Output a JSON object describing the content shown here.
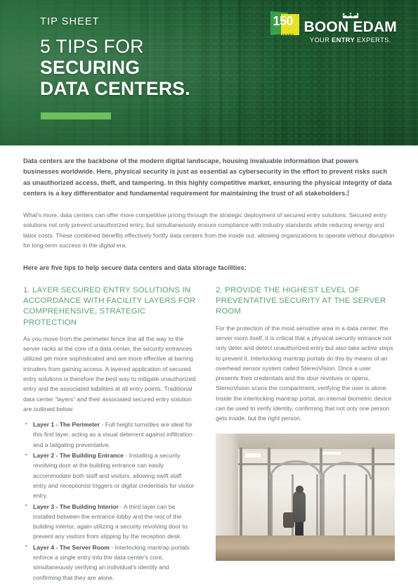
{
  "header": {
    "kicker": "TIP SHEET",
    "title_line_1": "5 TIPS FOR",
    "title_line_2": "SECURING",
    "title_line_3": "DATA CENTERS.",
    "accent_color": "#6ebf5d",
    "background_color": "#2d7a42",
    "photo_description": "data-center-server-racks-photo"
  },
  "logo": {
    "anniversary_number": "150",
    "anniversary_label": "YEARS",
    "brand": "BOON EDAM",
    "tagline_prefix": "YOUR ",
    "tagline_bold": "ENTRY",
    "tagline_suffix": " EXPERTS.",
    "badge_green": "#3aa14a",
    "badge_yellow": "#e6e324"
  },
  "intro": {
    "bold_paragraph": "Data centers are the backbone of the modern digital landscape, housing invaluable information that powers businesses worldwide. Here, physical security is just as essential as cybersecurity in the effort to prevent risks such as unauthorized access, theft, and tampering. In this highly competitive market, ensuring the physical integrity of data centers is a key differentiator and fundamental requirement for maintaining the trust of all stakeholders.",
    "regular_paragraph": "What's more, data centers can offer more competitive pricing through the strategic deployment of secured entry solutions. Secured entry solutions not only prevent unauthorized entry, but simultaneously ensure compliance with industry standards while reducing energy and labor costs. These combined benefits effectively fortify data centers from the inside out, allowing organizations to operate without disruption for long-term success in the digital era.",
    "lead_in": "Here are five tips to help secure data centers and data storage facilities:"
  },
  "sections": {
    "left": {
      "heading": "1. LAYER SECURED ENTRY SOLUTIONS IN ACCORDANCE WITH FACILITY LAYERS FOR COMPREHENSIVE, STRATEGIC PROTECTION",
      "body": "As you move from the perimeter fence line all the way to the server racks at the core of a data center, the security entrances utilized get more sophisticated and are more effective at barring intruders from gaining access. A layered application of secured entry solutions is therefore the best way to mitigate unauthorized entry and the associated liabilities at all entry points. Traditional data center “layers” and their associated secured entry solution are outlined below:",
      "bullets": [
        {
          "label": "Layer 1 - The Perimeter",
          "text": " - Full height turnstiles are ideal for this first layer, acting as a visual deterrent against infiltration and a tailgating preventative."
        },
        {
          "label": "Layer 2 - The Building Entrance",
          "text": " - Installing a security revolving door at the building entrance can easily accommodate both staff and visitors, allowing swift staff entry and receptionist triggers or digital credentials for visitor entry."
        },
        {
          "label": "Layer 3 - The Building Interior",
          "text": " - A third layer can be installed between the entrance lobby and the rest of the building interior, again utilizing a security revolving door to prevent any visitors from slipping by the reception desk."
        },
        {
          "label": "Layer 4 - The Server Room",
          "text": " - Interlocking mantrap portals enforce a single entry into the data center's core, simultaneously verifying an individual's identity and confirming that they are alone."
        }
      ]
    },
    "right": {
      "heading": "2. PROVIDE THE HIGHEST LEVEL OF PREVENTATIVE SECURITY AT THE SERVER ROOM",
      "body": "For the protection of the most sensitive area in a data center, the server room itself, it is critical that a physical security entrance not only deter and detect unauthorized entry but also take active steps to prevent it. Interlocking mantrap portals do this by means of an overhead sensor system called StereoVision. Once a user presents their credentials and the door revolves or opens, StereoVision scans the compartment, verifying the user is alone. Inside the interlocking mantrap portal, an internal biometric device can be used to verify identity, confirming that not only one person gets inside, but the right person.",
      "photo_description": "security-revolving-door-photo"
    }
  },
  "theme": {
    "heading_green": "#5aa277",
    "body_gray": "#6a6e72",
    "bold_gray": "#54585c"
  }
}
